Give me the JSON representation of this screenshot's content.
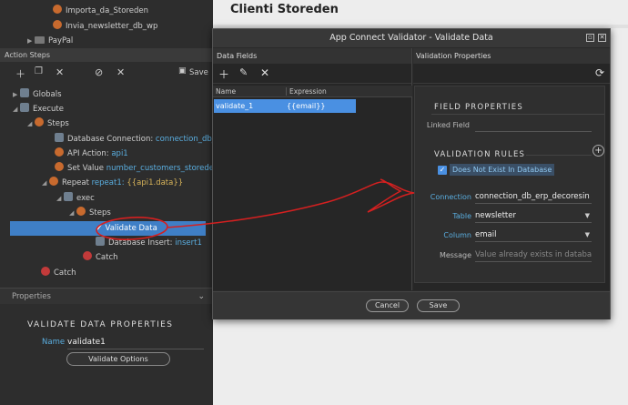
{
  "workspace": {
    "title": "Clienti Storeden"
  },
  "tree_top": [
    {
      "label": "Importa_da_Storeden"
    },
    {
      "label": "Invia_newsletter_db_wp"
    },
    {
      "label": "PayPal"
    }
  ],
  "action_steps": {
    "title": "Action Steps",
    "save_label": "Save",
    "items": [
      {
        "label": "Globals"
      },
      {
        "label": "Execute"
      },
      {
        "label": "Steps"
      },
      {
        "label": "Database Connection:",
        "value": "connection_db_erp_"
      },
      {
        "label": "API Action:",
        "value": "api1"
      },
      {
        "label": "Set Value",
        "value": "number_customers_storeden = "
      },
      {
        "label": "Repeat",
        "value": "repeat1:",
        "extra": "{{api1.data}}"
      },
      {
        "label": "exec"
      },
      {
        "label": "Steps"
      },
      {
        "label": "Validate Data"
      },
      {
        "label": "Database Insert:",
        "value": "insert1"
      },
      {
        "label": "Catch"
      },
      {
        "label": "Catch"
      }
    ]
  },
  "properties": {
    "header": "Properties",
    "title": "VALIDATE DATA PROPERTIES",
    "name_label": "Name",
    "name_value": "validate1",
    "options_button": "Validate Options"
  },
  "dialog": {
    "title": "App Connect Validator - Validate Data",
    "data_fields": {
      "header": "Data Fields",
      "columns": [
        "Name",
        "Expression"
      ],
      "rows": [
        {
          "name": "validate_1",
          "expression": "{{email}}"
        }
      ]
    },
    "validation_properties": {
      "header": "Validation Properties",
      "field_properties_title": "FIELD PROPERTIES",
      "linked_field_label": "Linked Field",
      "linked_field_value": "",
      "validation_rules_title": "VALIDATION RULES",
      "rule_label": "Does Not Exist In Database",
      "connection_label": "Connection",
      "connection_value": "connection_db_erp_decoresin",
      "table_label": "Table",
      "table_value": "newsletter",
      "column_label": "Column",
      "column_value": "email",
      "message_label": "Message",
      "message_placeholder": "Value already exists in database"
    },
    "cancel_label": "Cancel",
    "save_label": "Save"
  },
  "colors": {
    "accent": "#4a90e2",
    "link": "#5aaee0",
    "annotation": "#d42020"
  }
}
